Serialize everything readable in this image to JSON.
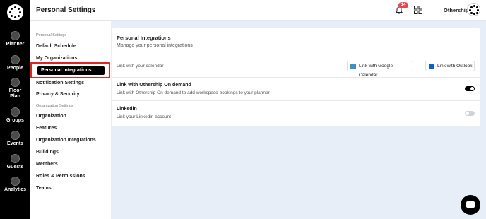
{
  "app": {
    "title": "Personal Settings",
    "notifications_count": "14",
    "org_name": "Othership"
  },
  "rail": {
    "items": [
      {
        "label": "Planner",
        "icon": "calendar-icon"
      },
      {
        "label": "People",
        "icon": "people-icon"
      },
      {
        "label": "Floor Plan",
        "icon": "floor-plan-icon"
      },
      {
        "label": "Groups",
        "icon": "groups-icon"
      },
      {
        "label": "Events",
        "icon": "events-icon"
      },
      {
        "label": "Guests",
        "icon": "guests-icon"
      },
      {
        "label": "Analytics",
        "icon": "analytics-icon"
      }
    ]
  },
  "nav": {
    "personal_section": "Personal Settings",
    "personal_items": [
      "Default Schedule",
      "My Organizations",
      "Personal Integrations",
      "Notification Settings",
      "Privacy & Security"
    ],
    "org_section": "Organization Settings",
    "org_items": [
      "Organization",
      "Features",
      "Organization Integrations",
      "Buildings",
      "Members",
      "Roles & Permissions",
      "Teams"
    ]
  },
  "card": {
    "title": "Personal Integrations",
    "subtitle": "Manage your personal integrations",
    "calendar_row": {
      "desc": "Link with your calendar",
      "google_btn": "Link with Google Calendar",
      "outlook_btn": "Link with Outlook"
    },
    "ondemand_row": {
      "title": "Link with Othership On demand",
      "desc": "Link with Othership On demand to add workspace bookings to your planner",
      "enabled": true
    },
    "linkedin_row": {
      "title": "Linkedin",
      "desc": "Link your Linkedin account",
      "enabled": false
    }
  },
  "colors": {
    "accent_red": "#e02424",
    "toggle_on": "#000000",
    "toggle_off": "#cfd3da",
    "background": "#e8eef7"
  }
}
